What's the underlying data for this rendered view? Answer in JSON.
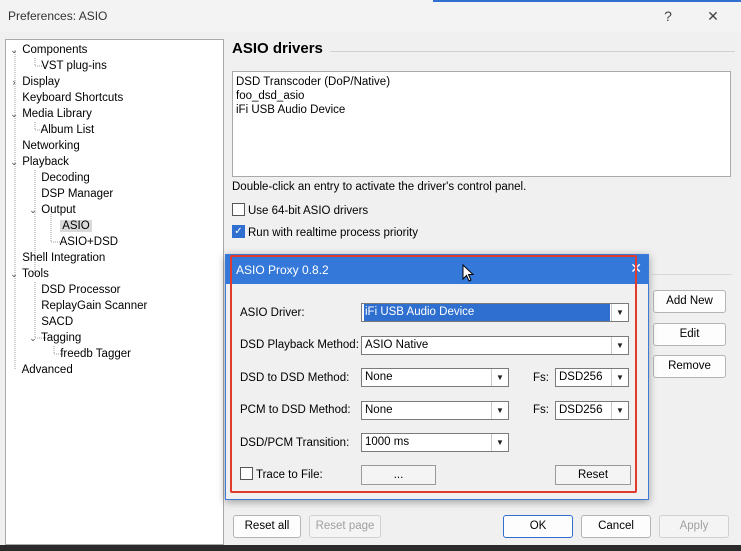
{
  "window": {
    "title": "Preferences: ASIO",
    "help_label": "?",
    "close_label": "✕"
  },
  "tree": {
    "items": [
      {
        "label": "Components",
        "expander": "⌄"
      },
      {
        "label": "VST plug-ins",
        "expander": ""
      },
      {
        "label": "Display",
        "expander": "›"
      },
      {
        "label": "Keyboard Shortcuts",
        "expander": ""
      },
      {
        "label": "Media Library",
        "expander": "⌄"
      },
      {
        "label": "Album List",
        "expander": ""
      },
      {
        "label": "Networking",
        "expander": ""
      },
      {
        "label": "Playback",
        "expander": "⌄"
      },
      {
        "label": "Decoding",
        "expander": ""
      },
      {
        "label": "DSP Manager",
        "expander": ""
      },
      {
        "label": "Output",
        "expander": "⌄"
      },
      {
        "label": "ASIO",
        "expander": ""
      },
      {
        "label": "ASIO+DSD",
        "expander": ""
      },
      {
        "label": "Shell Integration",
        "expander": ""
      },
      {
        "label": "Tools",
        "expander": "⌄"
      },
      {
        "label": "DSD Processor",
        "expander": ""
      },
      {
        "label": "ReplayGain Scanner",
        "expander": ""
      },
      {
        "label": "SACD",
        "expander": ""
      },
      {
        "label": "Tagging",
        "expander": "⌄"
      },
      {
        "label": "freedb Tagger",
        "expander": ""
      },
      {
        "label": "Advanced",
        "expander": ""
      }
    ],
    "selected": "ASIO"
  },
  "main": {
    "heading": "ASIO drivers",
    "drivers": [
      "DSD Transcoder (DoP/Native)",
      "foo_dsd_asio",
      "iFi USB Audio Device"
    ],
    "hint": "Double-click an entry to activate the driver's control panel.",
    "use64": {
      "label": "Use 64-bit ASIO drivers",
      "checked": false
    },
    "realtime": {
      "label": "Run with realtime process priority",
      "checked": true,
      "mark": "✓"
    },
    "add_new": "Add New",
    "edit": "Edit",
    "remove": "Remove"
  },
  "footer": {
    "reset_all": "Reset all",
    "reset_page": "Reset page",
    "ok": "OK",
    "cancel": "Cancel",
    "apply": "Apply"
  },
  "proxy": {
    "title": "ASIO Proxy 0.8.2",
    "close": "✕",
    "asio_driver_label": "ASIO Driver:",
    "asio_driver_value": "iFi USB Audio Device",
    "dsd_playback_label": "DSD Playback Method:",
    "dsd_playback_value": "ASIO Native",
    "dsd_to_dsd_label": "DSD to DSD Method:",
    "dsd_to_dsd_value": "None",
    "fs_label": "Fs:",
    "fs1_value": "DSD256",
    "pcm_to_dsd_label": "PCM to DSD Method:",
    "pcm_to_dsd_value": "None",
    "fs2_value": "DSD256",
    "transition_label": "DSD/PCM Transition:",
    "transition_value": "1000 ms",
    "trace_label": "Trace to File:",
    "trace_checked": false,
    "browse_label": "...",
    "reset_label": "Reset",
    "arrow": "▼"
  },
  "colors": {
    "accent": "#2f6fd0",
    "annotation": "#e03b2c"
  }
}
